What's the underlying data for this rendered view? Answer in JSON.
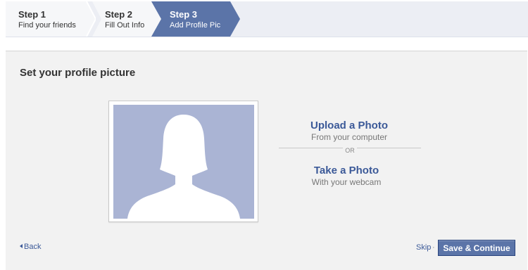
{
  "steps": [
    {
      "label": "Step 1",
      "sub": "Find your friends"
    },
    {
      "label": "Step 2",
      "sub": "Fill Out Info"
    },
    {
      "label": "Step 3",
      "sub": "Add Profile Pic"
    }
  ],
  "page": {
    "heading": "Set your profile picture",
    "upload": {
      "title": "Upload a Photo",
      "desc": "From your computer"
    },
    "or_text": "OR",
    "take": {
      "title": "Take a Photo",
      "desc": "With your webcam"
    }
  },
  "footer": {
    "back_label": "Back",
    "skip_label": "Skip",
    "separator": "·",
    "save_label": "Save & Continue"
  },
  "colors": {
    "brand": "#3b5998",
    "active_step": "#5b74a8",
    "placeholder_bg": "#aab4d4",
    "panel_bg": "#f2f2f2"
  },
  "icons": {
    "profile_placeholder": "silhouette-icon",
    "back": "left-arrow-icon"
  }
}
